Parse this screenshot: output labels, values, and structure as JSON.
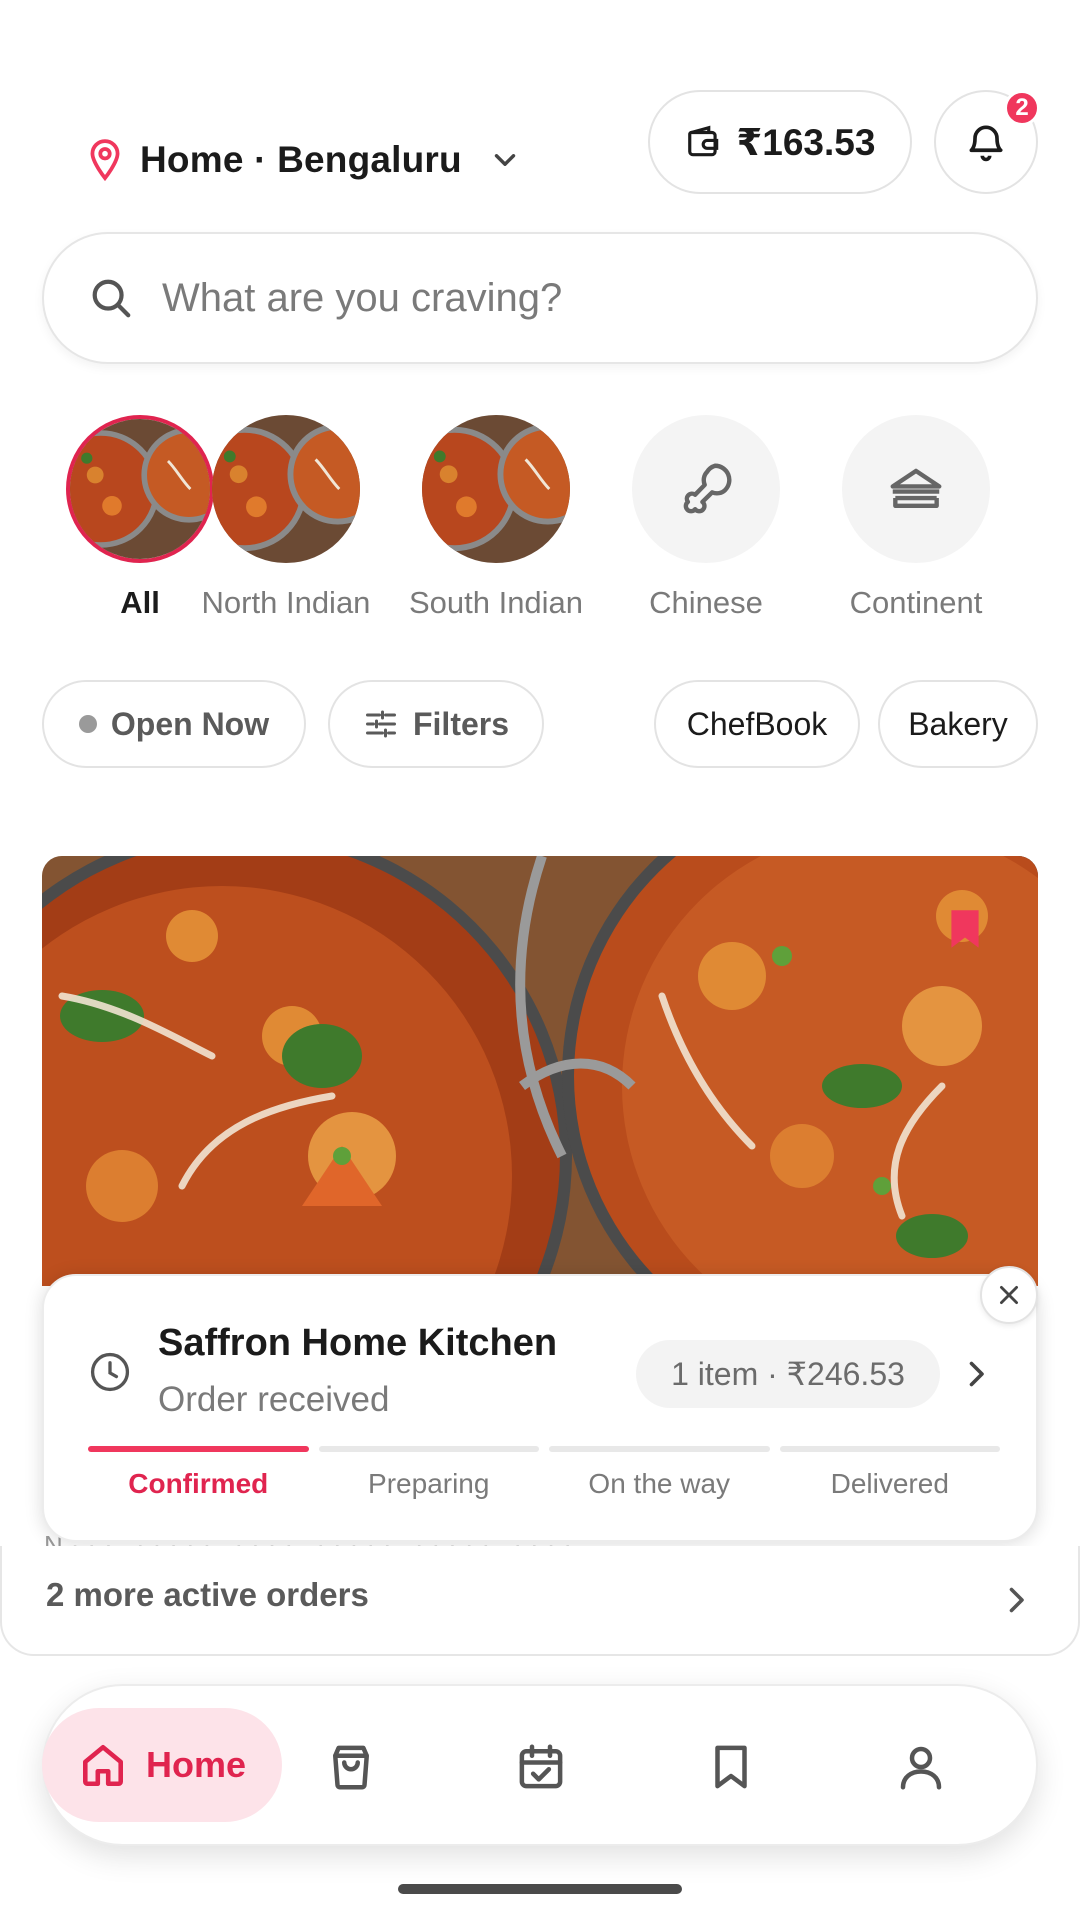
{
  "header": {
    "location_label": "Home · Bengaluru",
    "wallet_amount": "₹163.53",
    "notification_count": "2"
  },
  "search": {
    "placeholder": "What are you craving?"
  },
  "categories": [
    {
      "label": "All",
      "active": true
    },
    {
      "label": "North Indian",
      "active": false
    },
    {
      "label": "South Indian",
      "active": false
    },
    {
      "label": "Chinese",
      "active": false
    },
    {
      "label": "Continent",
      "active": false
    }
  ],
  "chips": {
    "open_now": "Open Now",
    "filters": "Filters",
    "chefbook": "ChefBook",
    "bakery": "Bakery"
  },
  "order": {
    "restaurant": "Saffron Home Kitchen",
    "status": "Order received",
    "summary": "1 item · ₹246.53",
    "steps": [
      "Confirmed",
      "Preparing",
      "On the way",
      "Delivered"
    ],
    "active_step": 0
  },
  "more_orders": "2 more active orders",
  "nav": {
    "home_label": "Home",
    "items": [
      "home-icon",
      "bag-icon",
      "calendar-check-icon",
      "bookmark-icon",
      "profile-icon"
    ]
  },
  "colors": {
    "accent": "#f0375d",
    "accent_dark": "#e0244f",
    "accent_soft": "#fde3e9"
  }
}
